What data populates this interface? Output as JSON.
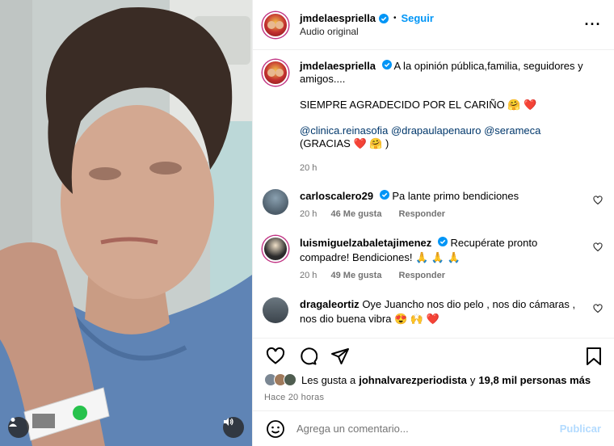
{
  "header": {
    "username": "jmdelaespriella",
    "follow_label": "Seguir",
    "subtitle": "Audio original",
    "more_label": "···"
  },
  "caption": {
    "username": "jmdelaespriella",
    "line1": "A la opinión pública,familia, seguidores y amigos....",
    "line2": "SIEMPRE AGRADECIDO POR EL CARIÑO 🤗 ❤️",
    "mentions": [
      "@clinica.reinasofia",
      "@drapaulapenauro",
      "@serameca"
    ],
    "line4": "(GRACIAS ❤️ 🤗 )",
    "time": "20 h"
  },
  "comments": [
    {
      "username": "carloscalero29",
      "text": "Pa lante primo bendiciones",
      "time": "20 h",
      "likes": "46 Me gusta",
      "reply": "Responder"
    },
    {
      "username": "luismiguelzabaletajimenez",
      "text": "Recupérate pronto compadre! Bendiciones! 🙏 🙏 🙏",
      "time": "20 h",
      "likes": "49 Me gusta",
      "reply": "Responder"
    },
    {
      "username": "dragaleortiz",
      "text": "Oye Juancho nos dio pelo , nos dio cámaras , nos dio buena vibra 😍 🙌 ❤️"
    }
  ],
  "likes": {
    "prefix": "Les gusta a",
    "user": "johnalvarezperiodista",
    "middle": "y",
    "count": "19,8 mil personas más",
    "time": "Hace 20 horas"
  },
  "add_comment": {
    "placeholder": "Agrega un comentario...",
    "post_label": "Publicar"
  },
  "colors": {
    "link": "#0095f6",
    "mention": "#00376b",
    "muted": "#737373",
    "post_disabled": "#b3dbff"
  }
}
